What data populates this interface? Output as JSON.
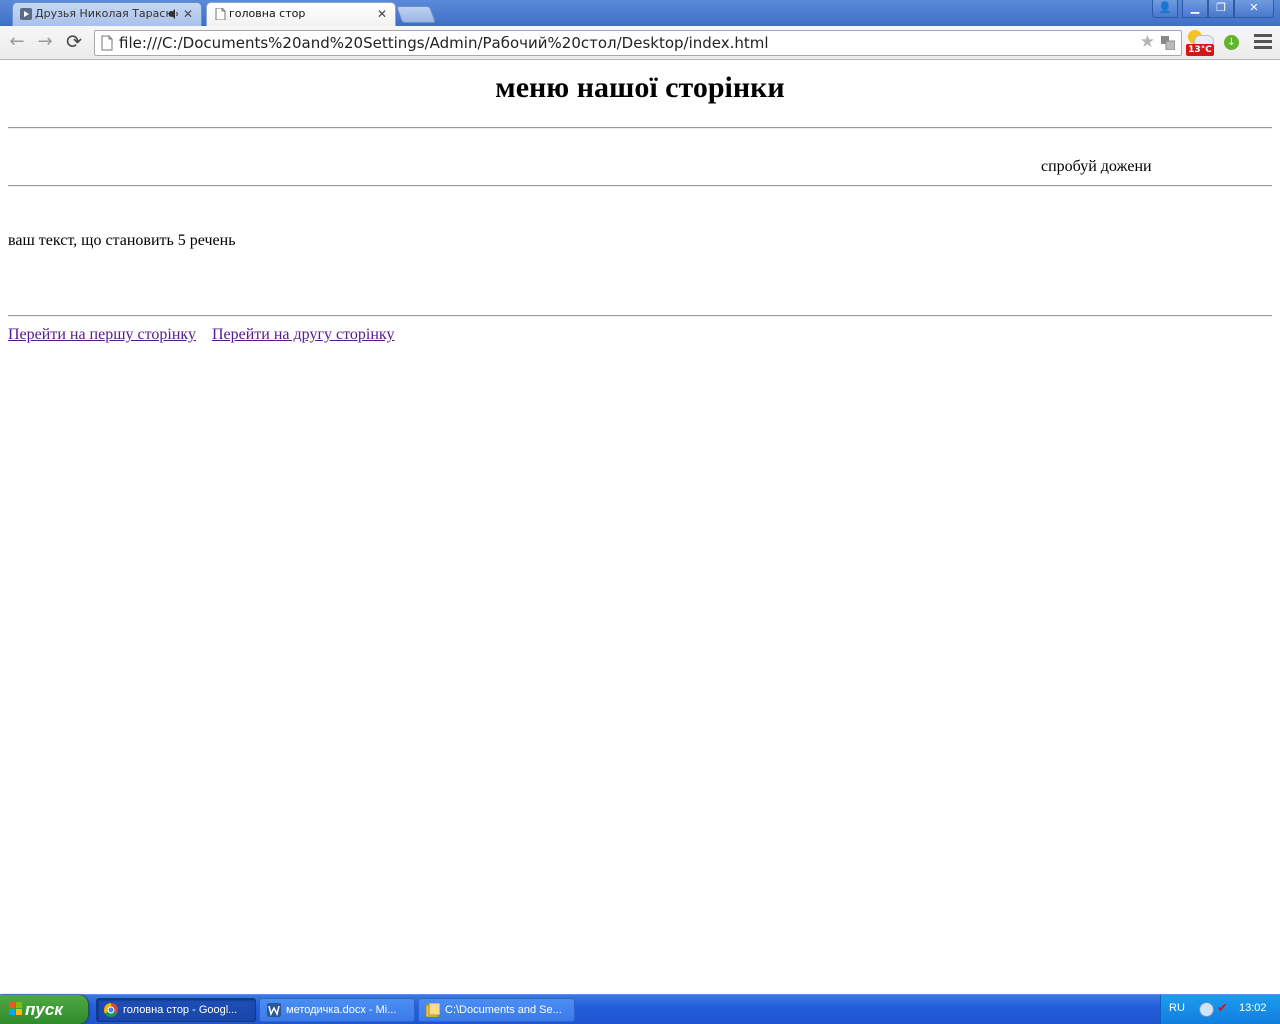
{
  "browser": {
    "tabs": [
      {
        "label": "Друзья Николая Тарасю",
        "active": false,
        "audio": true
      },
      {
        "label": "головна стор",
        "active": true,
        "audio": false
      }
    ],
    "tab_close_glyph": "✕",
    "window_controls": {
      "user": "👤",
      "minimize": "▁",
      "restore": "❐",
      "close": "✕"
    },
    "nav": {
      "back": "←",
      "forward": "→",
      "reload": "⟳"
    },
    "address": "file:///C:/Documents%20and%20Settings/Admin/Рабочий%20стол/Desktop/index.html",
    "weather_temp": "13°C"
  },
  "page": {
    "heading": "меню нашої сторінки",
    "try_text": "спробуй дожени",
    "body_text": "ваш текст, що становить 5 речень",
    "links": [
      "Перейти на першу сторінку",
      "Перейти на другу сторінку"
    ]
  },
  "taskbar": {
    "start_label": "пуск",
    "tasks": [
      {
        "label": "головна стор - Googl...",
        "active": true
      },
      {
        "label": "методичка.docx - Mi...",
        "active": false
      },
      {
        "label": "C:\\Documents and Se...",
        "active": false
      }
    ],
    "tray": {
      "lang": "RU",
      "clock": "13:02"
    }
  },
  "colors": {
    "link_visited": "#551a8b",
    "taskbar_blue": "#245edb",
    "start_green": "#3a9a35",
    "titlebar_blue": "#4a7ad0"
  }
}
